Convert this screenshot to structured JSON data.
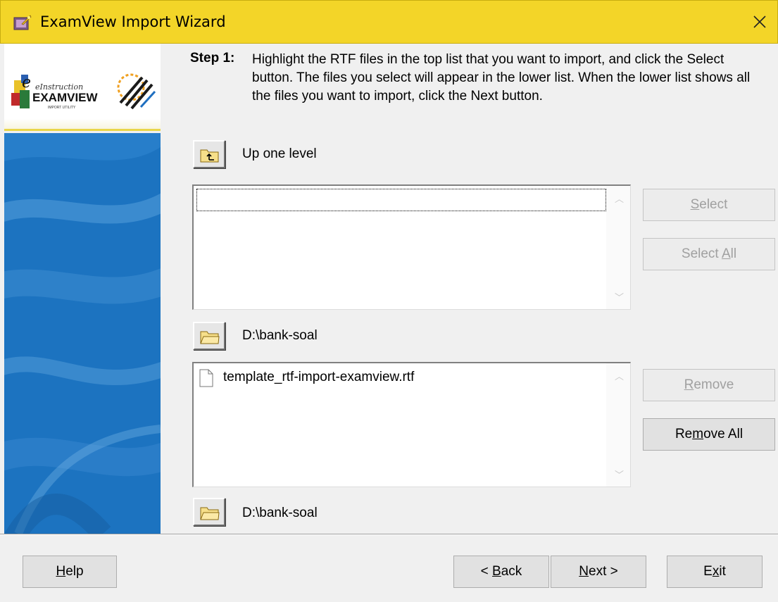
{
  "window": {
    "title": "ExamView Import Wizard"
  },
  "step": {
    "label": "Step 1:",
    "instructions": "Highlight the RTF files in the top list that you want to import, and click the Select button.  The files you select will appear in the lower list.  When the lower list shows all the files you want to import, click the Next button."
  },
  "source": {
    "up_label": "Up one level",
    "folder_path": "D:\\bank-soal"
  },
  "selected": {
    "files": [
      "template_rtf-import-examview.rtf"
    ],
    "folder_path": "D:\\bank-soal"
  },
  "buttons": {
    "select": {
      "pre": "",
      "key": "S",
      "post": "elect"
    },
    "select_all": {
      "pre": "Select ",
      "key": "A",
      "post": "ll"
    },
    "remove": {
      "pre": "",
      "key": "R",
      "post": "emove"
    },
    "remove_all": {
      "pre": "Re",
      "key": "m",
      "post": "ove All"
    },
    "help": {
      "pre": "",
      "key": "H",
      "post": "elp"
    },
    "back": {
      "pre": "< ",
      "key": "B",
      "post": "ack"
    },
    "next": {
      "pre": "",
      "key": "N",
      "post": "ext >"
    },
    "exit": {
      "pre": "E",
      "key": "x",
      "post": "it"
    }
  },
  "logo": {
    "brand_small": "eInstruction",
    "brand_main": "EXAMVIEW",
    "brand_sub": "IMPORT UTILITY"
  },
  "colors": {
    "titlebar": "#f3d528",
    "sidebar_blue": "#1c73c0",
    "accent_yellow": "#e9d64a"
  }
}
